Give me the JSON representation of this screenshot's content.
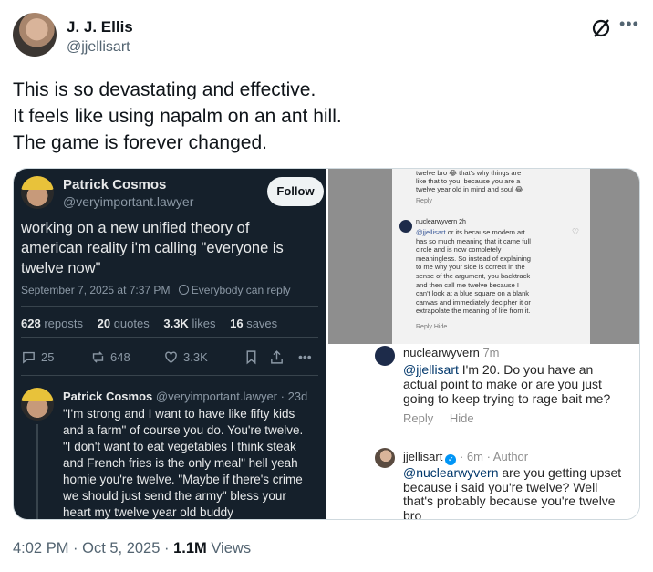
{
  "author": {
    "name": "J. J. Ellis",
    "handle": "@jjellisart"
  },
  "tweet": {
    "lines": [
      "This is so devastating and effective.",
      "It feels like using napalm on an ant hill.",
      "The game is forever changed."
    ]
  },
  "left_panel": {
    "name": "Patrick Cosmos",
    "handle": "@veryimportant.lawyer",
    "follow_label": "Follow",
    "text_lines": [
      "working on a new unified theory of",
      "american reality i'm calling \"everyone is",
      "twelve now\""
    ],
    "timestamp": "September 7, 2025 at 7:37 PM",
    "audience": "Everybody can reply",
    "stats": {
      "reposts_count": "628",
      "reposts_label": "reposts",
      "quotes_count": "20",
      "quotes_label": "quotes",
      "likes_count": "3.3K",
      "likes_label": "likes",
      "saves_count": "16",
      "saves_label": "saves"
    },
    "actions": {
      "replies": "25",
      "reposts": "648",
      "likes": "3.3K"
    },
    "reply": {
      "name": "Patrick Cosmos",
      "handle": "@veryimportant.lawyer",
      "age": "· 23d",
      "lines": [
        "\"I'm strong and I want to have like fifty kids",
        "and a farm\" of course you do. You're twelve.",
        "\"I don't want to eat vegetables I think steak",
        "and French fries is the only meal\" hell yeah",
        "homie you're twelve. \"Maybe if there's crime",
        "we should just send the army\" bless your",
        "heart my twelve year old buddy"
      ]
    }
  },
  "right_panel": {
    "inner_top_lines": [
      "twelve bro 😂 that's why things are",
      "like that to you, because you are a",
      "twelve year old in mind and soul 😂"
    ],
    "inner_top_action": "Reply",
    "inner_user": "nuclearwyvern 2h",
    "inner_mention": "@jjellisart",
    "inner_body_lines": [
      " or its because modern art",
      "has so much meaning that it came full",
      "circle and is now completely",
      "meaningless. So instead of explaining",
      "to me why your side is correct in the",
      "sense of the argument, you backtrack",
      "and then call me twelve because I",
      "can't look at a blue square on a blank",
      "canvas and immediately decipher it or",
      "extrapolate the meaning of life from it."
    ],
    "inner_actions": "Reply   Hide",
    "comment1": {
      "user": "nuclearwyvern",
      "time": "7m",
      "mention": "@jjellisart",
      "first_line_rest": " I'm 20. Do you have an",
      "lines": [
        "actual point to make or are you just",
        "going to keep trying to rage bait me?"
      ],
      "reply_label": "Reply",
      "hide_label": "Hide"
    },
    "comment2": {
      "user": "jjellisart",
      "meta": "· 6m · Author",
      "mention": "@nuclearwyvern",
      "first_line_rest": " are you getting upset",
      "lines": [
        "because i said you're twelve? Well",
        "that's probably because you're twelve",
        "bro"
      ]
    }
  },
  "footer": {
    "timestamp": "4:02 PM · Oct 5, 2025 · ",
    "views_count": "1.1M",
    "views_label": " Views"
  }
}
